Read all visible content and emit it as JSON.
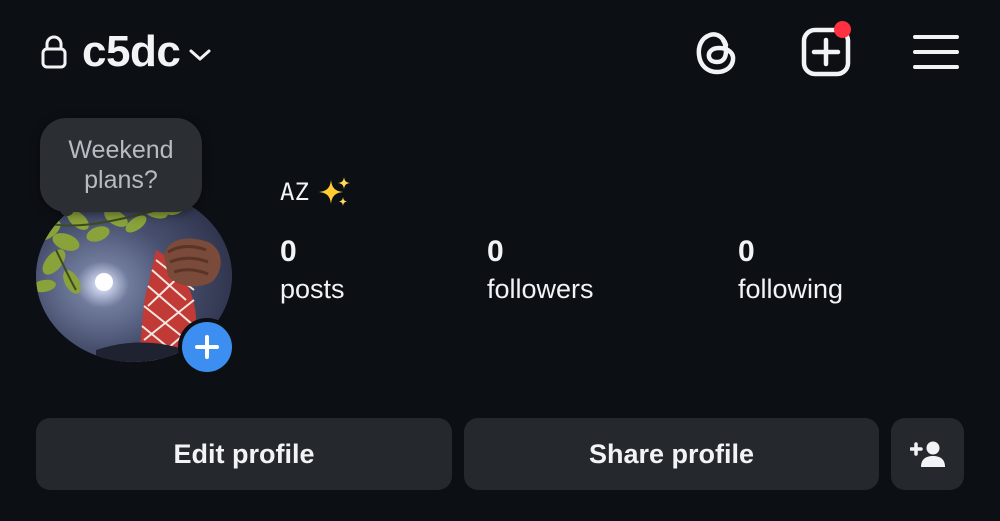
{
  "header": {
    "username": "c5dc",
    "icons": {
      "lock": "lock-icon",
      "chevron": "chevron-down-icon",
      "threads": "threads-icon",
      "create": "create-plus-icon",
      "menu": "hamburger-menu-icon"
    },
    "create_has_notification": true
  },
  "profile": {
    "note": {
      "line1": "Weekend",
      "line2": "plans?"
    },
    "display_name": "AZ",
    "display_name_emoji": "sparkles-icon",
    "stats": [
      {
        "count": "0",
        "label": "posts"
      },
      {
        "count": "0",
        "label": "followers"
      },
      {
        "count": "0",
        "label": "following"
      }
    ]
  },
  "actions": {
    "edit_label": "Edit profile",
    "share_label": "Share profile",
    "suggest_icon": "add-person-icon"
  },
  "colors": {
    "background": "#0c0f14",
    "button": "#25292e",
    "note_bubble": "#2b2e33",
    "accent_blue": "#3c8ff0",
    "notification_red": "#ff3040",
    "text": "#f2f3f5"
  }
}
